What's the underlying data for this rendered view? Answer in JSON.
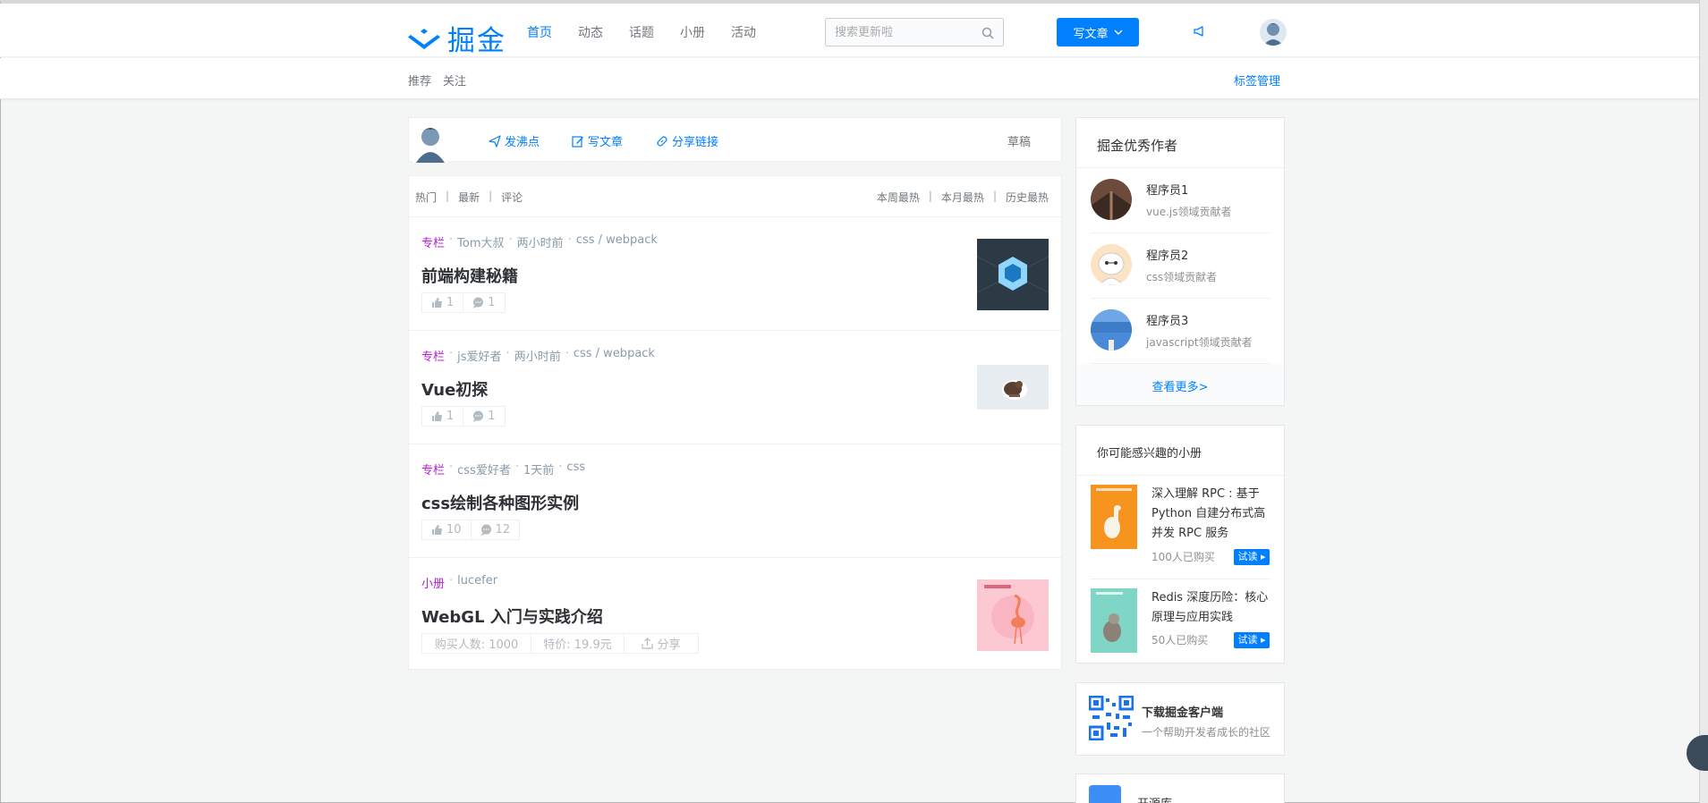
{
  "header": {
    "logo_text": "掘金",
    "nav": [
      "首页",
      "动态",
      "话题",
      "小册",
      "活动"
    ],
    "search_placeholder": "搜索更新啦",
    "write_button": "写文章"
  },
  "subnav": {
    "left": [
      "推荐",
      "关注"
    ],
    "right": "标签管理"
  },
  "composer": {
    "pin": "发沸点",
    "write": "写文章",
    "share": "分享链接",
    "draft": "草稿"
  },
  "feed": {
    "tabs_left": [
      "热门",
      "最新",
      "评论"
    ],
    "tabs_right": [
      "本周最热",
      "本月最热",
      "历史最热"
    ],
    "items": [
      {
        "tag": "专栏",
        "author": "Tom大叔",
        "time": "两小时前",
        "topics": "css / webpack",
        "title": "前端构建秘籍",
        "likes": "1",
        "comments": "1"
      },
      {
        "tag": "专栏",
        "author": "js爱好者",
        "time": "两小时前",
        "topics": "css / webpack",
        "title": "Vue初探",
        "likes": "1",
        "comments": "1"
      },
      {
        "tag": "专栏",
        "author": "css爱好者",
        "time": "1天前",
        "topics": "css",
        "title": "css绘制各种图形实例",
        "likes": "10",
        "comments": "12"
      },
      {
        "tag": "小册",
        "author": "lucefer",
        "title": "WebGL 入门与实践介绍",
        "buyers": "购买人数: 1000",
        "price": "特价: 19.9元",
        "share": "分享"
      }
    ]
  },
  "authors_card": {
    "title": "掘金优秀作者",
    "authors": [
      {
        "name": "程序员1",
        "desc": "vue.js领域贡献者"
      },
      {
        "name": "程序员2",
        "desc": "css领域贡献者"
      },
      {
        "name": "程序员3",
        "desc": "javascript领域贡献者"
      }
    ],
    "more": "查看更多>"
  },
  "books_card": {
    "title": "你可能感兴趣的小册",
    "books": [
      {
        "title": "深入理解 RPC : 基于 Python 自建分布式高并发 RPC 服务",
        "buyers": "100人已购买",
        "try": "试读"
      },
      {
        "title": "Redis 深度历险：核心原理与应用实践",
        "buyers": "50人已购买",
        "try": "试读"
      }
    ]
  },
  "app_card": {
    "title": "下载掘金客户端",
    "subtitle": "一个帮助开发者成长的社区"
  },
  "open_card": {
    "title": "开源库"
  },
  "colors": {
    "accent": "#007fff",
    "tag": "#b71ed7",
    "background": "#f4f5f5"
  }
}
